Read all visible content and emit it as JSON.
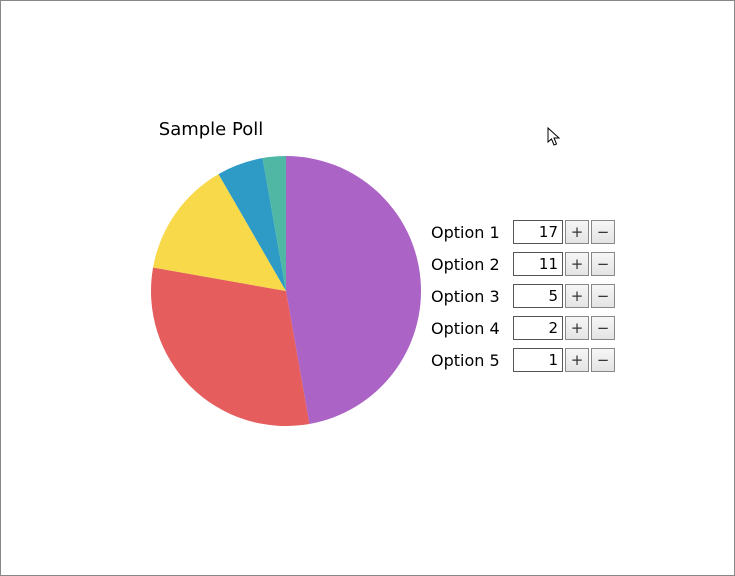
{
  "chart_data": {
    "type": "pie",
    "title": "Sample Poll",
    "series": [
      {
        "name": "Option 1",
        "value": 17,
        "color": "#ab63c6"
      },
      {
        "name": "Option 2",
        "value": 11,
        "color": "#e55d5d"
      },
      {
        "name": "Option 3",
        "value": 5,
        "color": "#f8d94a"
      },
      {
        "name": "Option 4",
        "value": 2,
        "color": "#2e9bc6"
      },
      {
        "name": "Option 5",
        "value": 1,
        "color": "#4fb7a3"
      }
    ]
  },
  "controls": {
    "plus_label": "+",
    "minus_label": "−",
    "rows": [
      {
        "label": "Option 1",
        "value": 17
      },
      {
        "label": "Option 2",
        "value": 11
      },
      {
        "label": "Option 3",
        "value": 5
      },
      {
        "label": "Option 4",
        "value": 2
      },
      {
        "label": "Option 5",
        "value": 1
      }
    ]
  }
}
